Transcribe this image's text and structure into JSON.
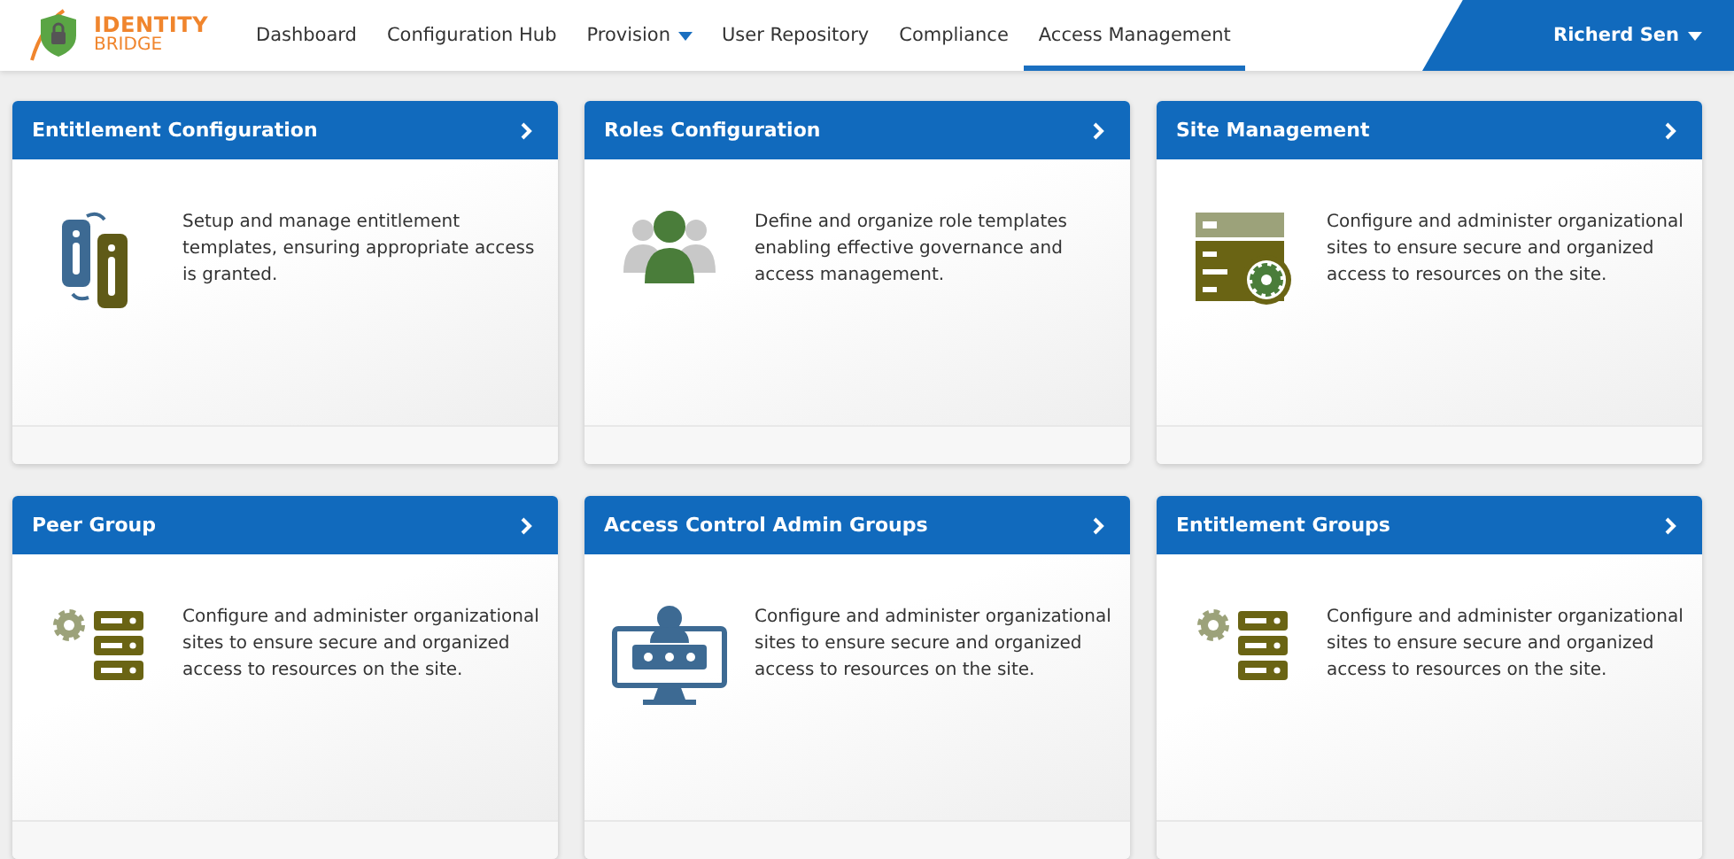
{
  "logo": {
    "line_1": "IDENTITY",
    "line_2": "BRIDGE"
  },
  "nav": [
    {
      "label": "Dashboard",
      "selected": false,
      "has_menu": false
    },
    {
      "label": "Configuration Hub",
      "selected": false,
      "has_menu": false
    },
    {
      "label": "Provision",
      "selected": false,
      "has_menu": true
    },
    {
      "label": "User Repository",
      "selected": false,
      "has_menu": false
    },
    {
      "label": "Compliance",
      "selected": false,
      "has_menu": false
    },
    {
      "label": "Access Management",
      "selected": true,
      "has_menu": false
    }
  ],
  "user": {
    "name": "Richerd Sen"
  },
  "cards": [
    {
      "title": "Entitlement Configuration",
      "kind": "entitlement",
      "description": "Setup and manage entitlement templates, ensuring appropriate access is granted."
    },
    {
      "title": "Roles Configuration",
      "kind": "roles",
      "description": "Define and organize role templates enabling effective governance and access management."
    },
    {
      "title": "Site Management",
      "kind": "site",
      "description": "Configure and administer organizational sites to ensure secure and organized access to resources on the site."
    },
    {
      "title": "Peer Group",
      "kind": "server-gear",
      "description": "Configure and administer organizational sites to ensure secure and organized access to resources on the site."
    },
    {
      "title": "Access Control Admin Groups",
      "kind": "monitor-password",
      "description": "Configure and administer organizational sites to ensure secure and organized access to resources on the site."
    },
    {
      "title": "Entitlement Groups",
      "kind": "server-gear",
      "description": "Configure and administer organizational sites to ensure secure and organized access to resources on the site."
    }
  ]
}
